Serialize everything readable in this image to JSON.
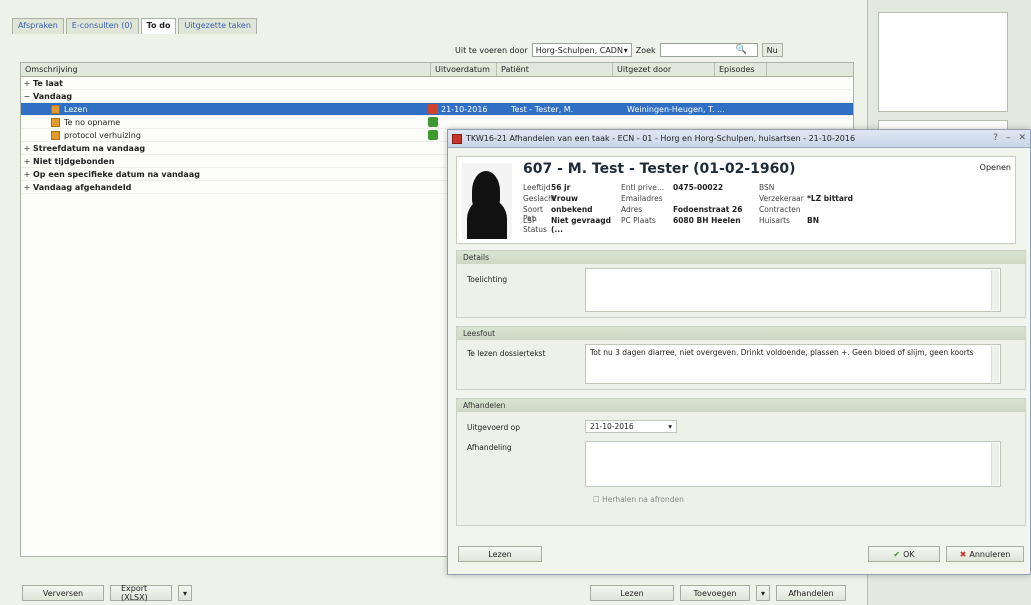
{
  "tabs": [
    "Afspraken",
    "E-consulten (0)",
    "To do",
    "Uitgezette taken"
  ],
  "active_tab": 2,
  "filter": {
    "label": "Uit te voeren door",
    "value": "Horg-Schulpen, CADN",
    "search_label": "Zoek",
    "search_button": "Nu"
  },
  "grid": {
    "columns": [
      "Omschrijving",
      "Uitvoerdatum",
      "Patiënt",
      "Uitgezet door",
      "Episodes"
    ],
    "rows": [
      {
        "expand": "+",
        "text": "Te laat",
        "type": "group"
      },
      {
        "expand": "−",
        "text": "Vandaag",
        "type": "group"
      },
      {
        "text": "Lezen",
        "type": "item",
        "selected": true,
        "status": "red",
        "date": "21-10-2016",
        "patient": "Test - Tester, M.",
        "by": "Weiningen-Heugen, T. ..."
      },
      {
        "text": "Te no opname",
        "type": "item",
        "status": "green"
      },
      {
        "text": "protocol verhuizing",
        "type": "item",
        "status": "green"
      },
      {
        "expand": "+",
        "text": "Streefdatum na vandaag",
        "type": "group"
      },
      {
        "expand": "+",
        "text": "Niet tijdgebonden",
        "type": "group"
      },
      {
        "expand": "+",
        "text": "Op een specifieke datum na vandaag",
        "type": "group"
      },
      {
        "expand": "+",
        "text": "Vandaag afgehandeld",
        "type": "group"
      }
    ]
  },
  "bottom_left": {
    "refresh": "Verversen",
    "export": "Export (XLSX)"
  },
  "bottom_right": {
    "open": "Lezen",
    "add": "Toevoegen",
    "handle": "Afhandelen"
  },
  "dialog": {
    "title": "TKW16-21 Afhandelen van een taak - ECN - 01 - Horg en Horg-Schulpen, huisartsen - 21-10-2016",
    "openen": "Openen",
    "patient": {
      "name": "607 - M. Test - Tester (01-02-1960)",
      "rows": [
        [
          {
            "l": "Leeftijd",
            "v": "56 jr"
          },
          {
            "l": "Entl prive...",
            "v": "0475-00022"
          },
          {
            "l": "BSN",
            "v": ""
          }
        ],
        [
          {
            "l": "Geslacht",
            "v": "Vrouw"
          },
          {
            "l": "Emailadres",
            "v": ""
          },
          {
            "l": "Verzekeraar",
            "v": "*LZ bittard"
          }
        ],
        [
          {
            "l": "Soort Pat.",
            "v": "onbekend"
          },
          {
            "l": "Adres",
            "v": "Fodoenstraat 26"
          },
          {
            "l": "Contracten",
            "v": ""
          }
        ],
        [
          {
            "l": "LSP Status",
            "v": "Niet gevraagd (..."
          },
          {
            "l": "PC Plaats",
            "v": "6080 BH Heelen"
          },
          {
            "l": "Huisarts",
            "v": "BN"
          }
        ]
      ]
    },
    "section1": {
      "header": "Details",
      "label": "Toelichting",
      "value": ""
    },
    "section2": {
      "header": "Leesfout",
      "label": "Te lezen dossiertekst",
      "value": "Tot nu 3 dagen diarree, niet overgeven. Drinkt voldoende, plassen +. Geen bloed of slijm, geen koorts"
    },
    "section3": {
      "header": "Afhandelen",
      "date_label": "Uitgevoerd op",
      "date_value": "21-10-2016",
      "handling_label": "Afhandeling",
      "handling_value": "",
      "checkbox_label": "Herhalen na afronden"
    },
    "btn_open": "Lezen",
    "btn_ok": "OK",
    "btn_cancel": "Annuleren"
  }
}
